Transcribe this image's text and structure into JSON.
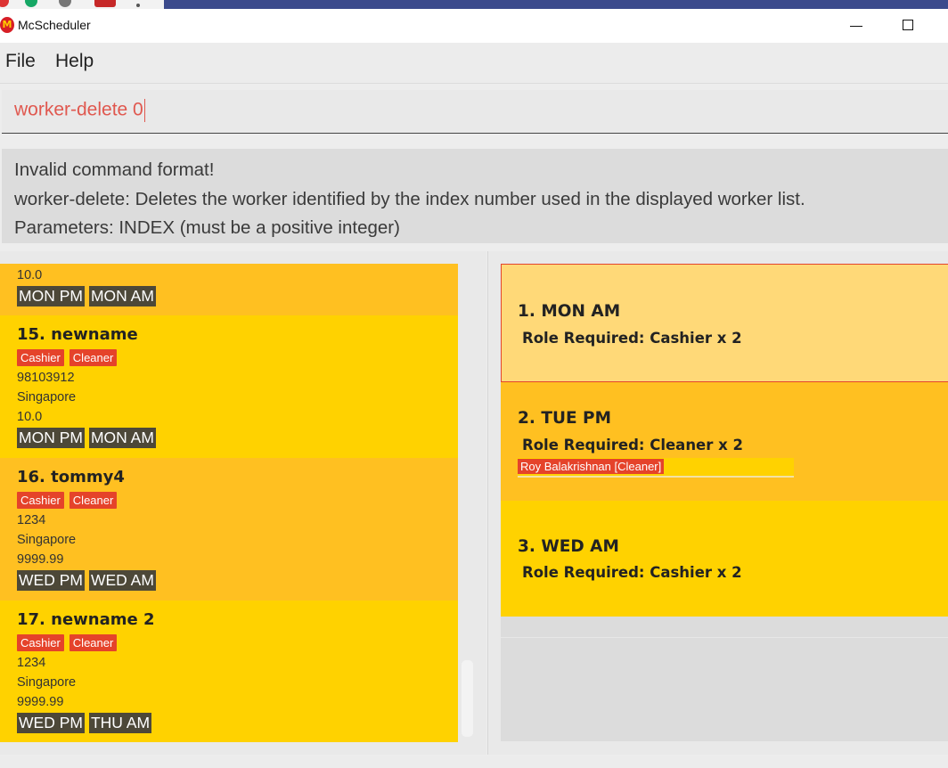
{
  "window": {
    "title": "McScheduler",
    "logo_glyph": "M"
  },
  "menu": {
    "file": "File",
    "help": "Help"
  },
  "command": {
    "value": "worker-delete 0"
  },
  "result": {
    "lines": [
      "Invalid command format!",
      "worker-delete: Deletes the worker identified by the index number used in the displayed worker list.",
      "Parameters: INDEX (must be a positive integer)"
    ]
  },
  "workers": {
    "partial": {
      "pay": "10.0",
      "shifts": [
        "MON PM",
        "MON AM"
      ]
    },
    "items": [
      {
        "header": "15.  newname",
        "roles": [
          "Cashier",
          "Cleaner"
        ],
        "phone": "98103912",
        "address": "Singapore",
        "pay": "10.0",
        "shifts": [
          "MON PM",
          "MON AM"
        ]
      },
      {
        "header": "16.  tommy4",
        "roles": [
          "Cashier",
          "Cleaner"
        ],
        "phone": "1234",
        "address": "Singapore",
        "pay": "9999.99",
        "shifts": [
          "WED PM",
          "WED AM"
        ]
      },
      {
        "header": "17.  newname 2",
        "roles": [
          "Cashier",
          "Cleaner"
        ],
        "phone": "1234",
        "address": "Singapore",
        "pay": "9999.99",
        "shifts": [
          "WED PM",
          "THU AM"
        ]
      }
    ]
  },
  "shifts": {
    "items": [
      {
        "header": "1.  MON AM",
        "role": "Role Required: Cashier x 2"
      },
      {
        "header": "2.  TUE PM",
        "role": "Role Required: Cleaner x 2",
        "assigned": "Roy Balakrishnan [Cleaner]"
      },
      {
        "header": "3.  WED AM",
        "role": "Role Required: Cashier x 2"
      }
    ]
  },
  "colors": {
    "card_dark": "#ffc021",
    "card_light": "#ffd200",
    "selected_card": "#ffd978",
    "role_tag": "#e5432a",
    "shift_tag": "#4d4838",
    "command_text": "#e0584f"
  }
}
